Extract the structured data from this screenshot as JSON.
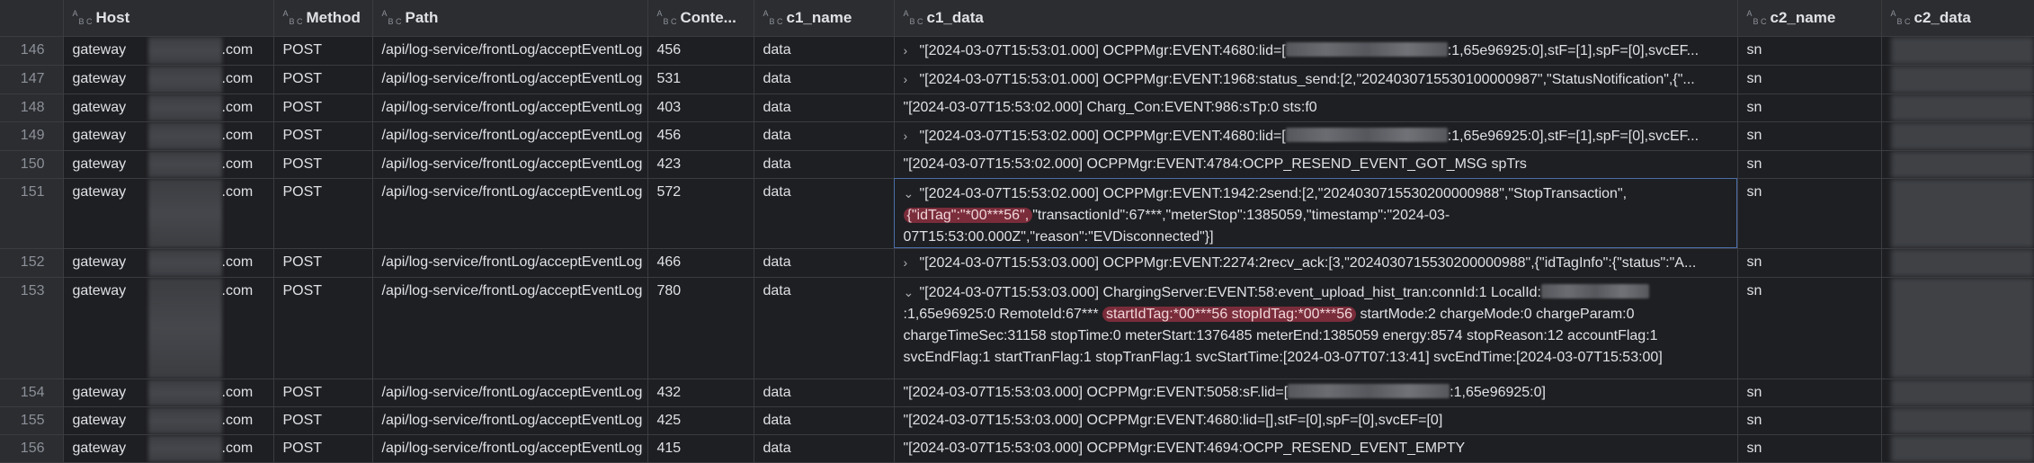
{
  "columns": [
    {
      "label": "",
      "type": ""
    },
    {
      "label": "Host",
      "type": "A B C"
    },
    {
      "label": "Method",
      "type": "A B C"
    },
    {
      "label": "Path",
      "type": "A B C"
    },
    {
      "label": "Conte...",
      "type": "A B C"
    },
    {
      "label": "c1_name",
      "type": "A B C"
    },
    {
      "label": "c1_data",
      "type": "A B C"
    },
    {
      "label": "c2_name",
      "type": "A B C"
    },
    {
      "label": "c2_data",
      "type": "A B C"
    }
  ],
  "rows": [
    {
      "idx": "146",
      "host_a": "gateway",
      "host_b": ".com",
      "method": "POST",
      "path": "/api/log-service/frontLog/acceptEventLog",
      "content": "456",
      "c1_name": "data",
      "c1_pre": "\"[2024-03-07T15:53:01.000] OCPPMgr:EVENT:4680:lid=[",
      "c1_post": ":1,65e96925:0],stF=[1],spF=[0],svcEF...",
      "c2_name": "sn"
    },
    {
      "idx": "147",
      "host_a": "gateway",
      "host_b": ".com",
      "method": "POST",
      "path": "/api/log-service/frontLog/acceptEventLog",
      "content": "531",
      "c1_name": "data",
      "c1_text": "\"[2024-03-07T15:53:01.000] OCPPMgr:EVENT:1968:status_send:[2,\"2024030715530100000987\",\"StatusNotification\",{\"...",
      "c2_name": "sn"
    },
    {
      "idx": "148",
      "host_a": "gateway",
      "host_b": ".com",
      "method": "POST",
      "path": "/api/log-service/frontLog/acceptEventLog",
      "content": "403",
      "c1_name": "data",
      "c1_text": "\"[2024-03-07T15:53:02.000] Charg_Con:EVENT:986:sTp:0 sts:f0",
      "c2_name": "sn"
    },
    {
      "idx": "149",
      "host_a": "gateway",
      "host_b": ".com",
      "method": "POST",
      "path": "/api/log-service/frontLog/acceptEventLog",
      "content": "456",
      "c1_name": "data",
      "c1_pre": "\"[2024-03-07T15:53:02.000] OCPPMgr:EVENT:4680:lid=[",
      "c1_post": ":1,65e96925:0],stF=[1],spF=[0],svcEF...",
      "c2_name": "sn"
    },
    {
      "idx": "150",
      "host_a": "gateway",
      "host_b": ".com",
      "method": "POST",
      "path": "/api/log-service/frontLog/acceptEventLog",
      "content": "423",
      "c1_name": "data",
      "c1_text": "\"[2024-03-07T15:53:02.000] OCPPMgr:EVENT:4784:OCPP_RESEND_EVENT_GOT_MSG spTrs",
      "c2_name": "sn"
    },
    {
      "idx": "151",
      "host_a": "gateway",
      "host_b": ".com",
      "method": "POST",
      "path": "/api/log-service/frontLog/acceptEventLog",
      "content": "572",
      "c1_name": "data",
      "c1_l1": "\"[2024-03-07T15:53:02.000] OCPPMgr:EVENT:1942:2send:[2,\"2024030715530200000988\",\"StopTransaction\",",
      "c1_hl": "{\"idTag\":\"*00***56\",",
      "c1_l2": "\"transactionId\":67***,\"meterStop\":1385059,\"timestamp\":\"2024-03-07T15:53:00.000Z\",\"reason\":\"EVDisconnected\"}]",
      "c2_name": "sn"
    },
    {
      "idx": "152",
      "host_a": "gateway",
      "host_b": ".com",
      "method": "POST",
      "path": "/api/log-service/frontLog/acceptEventLog",
      "content": "466",
      "c1_name": "data",
      "c1_text": "\"[2024-03-07T15:53:03.000] OCPPMgr:EVENT:2274:2recv_ack:[3,\"2024030715530200000988\",{\"idTagInfo\":{\"status\":\"A...",
      "c2_name": "sn"
    },
    {
      "idx": "153",
      "host_a": "gateway",
      "host_b": ".com",
      "method": "POST",
      "path": "/api/log-service/frontLog/acceptEventLog",
      "content": "780",
      "c1_name": "data",
      "c1_a": "\"[2024-03-07T15:53:03.000] ChargingServer:EVENT:58:event_upload_hist_tran:connId:1 LocalId:",
      "c1_b": ":1,65e96925:0 RemoteId:67***",
      "c1_hl": "startIdTag:*00***56 stopIdTag:*00***56",
      "c1_c": " startMode:2 chargeMode:0 chargeParam:0 chargeTimeSec:31158 stopTime:0 meterStart:1376485 meterEnd:1385059 energy:8574 stopReason:12 accountFlag:1 svcEndFlag:1 startTranFlag:1 stopTranFlag:1 svcStartTime:[2024-03-07T07:13:41] svcEndTime:[2024-03-07T15:53:00]",
      "c2_name": "sn"
    },
    {
      "idx": "154",
      "host_a": "gateway",
      "host_b": ".com",
      "method": "POST",
      "path": "/api/log-service/frontLog/acceptEventLog",
      "content": "432",
      "c1_name": "data",
      "c1_pre": "\"[2024-03-07T15:53:03.000] OCPPMgr:EVENT:5058:sF.lid=[",
      "c1_post": ":1,65e96925:0]",
      "c2_name": "sn"
    },
    {
      "idx": "155",
      "host_a": "gateway",
      "host_b": ".com",
      "method": "POST",
      "path": "/api/log-service/frontLog/acceptEventLog",
      "content": "425",
      "c1_name": "data",
      "c1_text": "\"[2024-03-07T15:53:03.000] OCPPMgr:EVENT:4680:lid=[],stF=[0],spF=[0],svcEF=[0]",
      "c2_name": "sn"
    },
    {
      "idx": "156",
      "host_a": "gateway",
      "host_b": ".com",
      "method": "POST",
      "path": "/api/log-service/frontLog/acceptEventLog",
      "content": "415",
      "c1_name": "data",
      "c1_text": "\"[2024-03-07T15:53:03.000] OCPPMgr:EVENT:4694:OCPP_RESEND_EVENT_EMPTY",
      "c2_name": "sn"
    }
  ],
  "icons": {
    "expand": "chevron-right-icon",
    "collapse": "chevron-down-icon",
    "type": "abc-type-icon"
  }
}
